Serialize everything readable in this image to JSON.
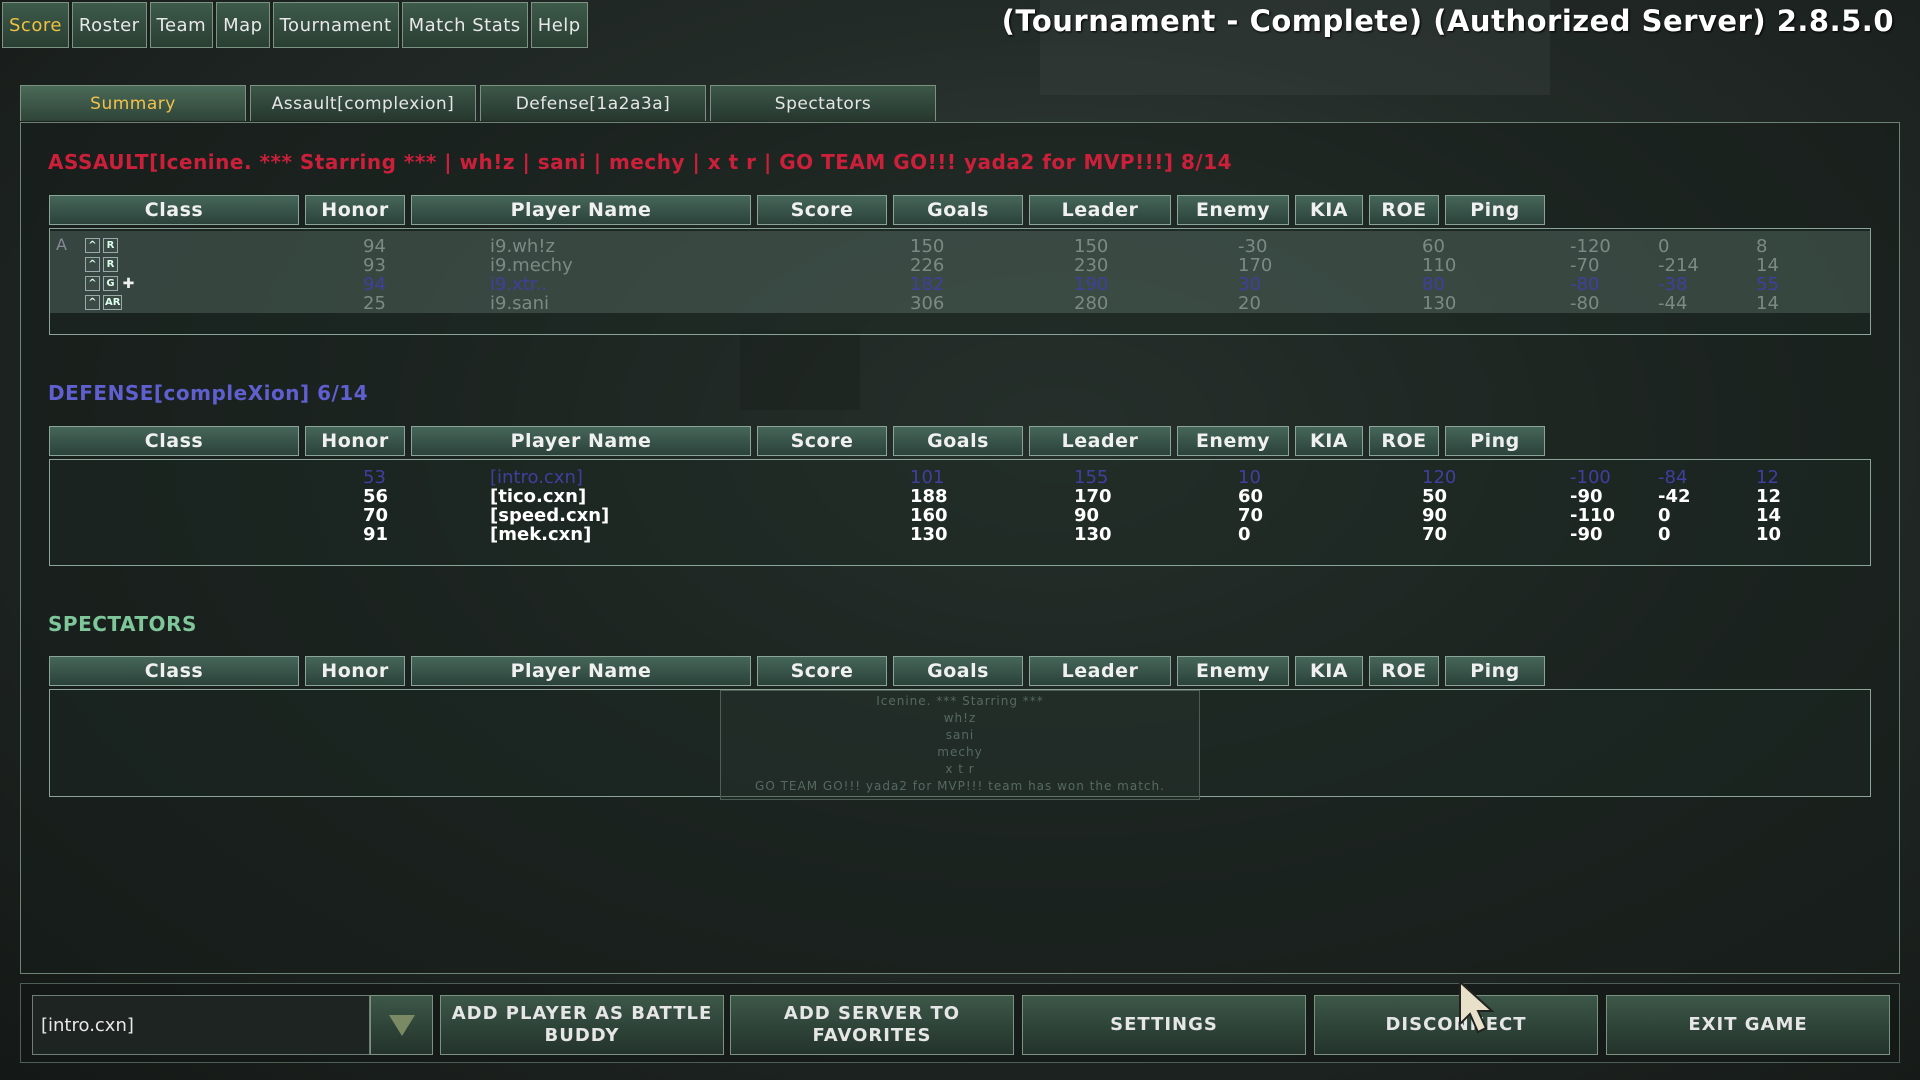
{
  "top_menu": [
    "Score",
    "Roster",
    "Team",
    "Map",
    "Tournament",
    "Match Stats",
    "Help"
  ],
  "server_title": "(Tournament - Complete) (Authorized Server)  2.8.5.0",
  "sub_tabs": [
    "Summary",
    "Assault[complexion]",
    "Defense[1a2a3a]",
    "Spectators"
  ],
  "columns": [
    "Class",
    "Honor",
    "Player Name",
    "Score",
    "Goals",
    "Leader",
    "Enemy",
    "KIA",
    "ROE",
    "Ping"
  ],
  "colors": {
    "assault": "#cc1f3a",
    "defense": "#5f5fd0",
    "spectators": "#7fc79a",
    "highlight": "#3f3f9f",
    "dim": "#7d8a84",
    "active_tab": "#f0c040"
  },
  "assault": {
    "heading": "ASSAULT[Icenine.  ***  Starring  ***  |  wh!z  |  sani  |  mechy  |  x t r  |  GO TEAM GO!!!  yada2 for MVP!!!] 8/14",
    "slot": "A",
    "rows": [
      {
        "icons": [
          "up",
          "R"
        ],
        "honor": "94",
        "name": "i9.wh!z",
        "score": "150",
        "goals": "150",
        "leader": "-30",
        "enemy": "60",
        "kia": "-120",
        "roe": "0",
        "ping": "8"
      },
      {
        "icons": [
          "up",
          "R"
        ],
        "honor": "93",
        "name": "i9.mechy",
        "score": "226",
        "goals": "230",
        "leader": "170",
        "enemy": "110",
        "kia": "-70",
        "roe": "-214",
        "ping": "14"
      },
      {
        "icons": [
          "up",
          "G",
          "+"
        ],
        "honor": "94",
        "name": "i9.xtr..",
        "score": "182",
        "goals": "190",
        "leader": "30",
        "enemy": "80",
        "kia": "-80",
        "roe": "-38",
        "ping": "55"
      },
      {
        "icons": [
          "up",
          "AR"
        ],
        "honor": "25",
        "name": "i9.sani",
        "score": "306",
        "goals": "280",
        "leader": "20",
        "enemy": "130",
        "kia": "-80",
        "roe": "-44",
        "ping": "14"
      }
    ]
  },
  "defense": {
    "heading": "DEFENSE[compleXion] 6/14",
    "rows": [
      {
        "honor": "53",
        "name": "[intro.cxn]",
        "score": "101",
        "goals": "155",
        "leader": "10",
        "enemy": "120",
        "kia": "-100",
        "roe": "-84",
        "ping": "12"
      },
      {
        "honor": "56",
        "name": "[tico.cxn]",
        "score": "188",
        "goals": "170",
        "leader": "60",
        "enemy": "50",
        "kia": "-90",
        "roe": "-42",
        "ping": "12"
      },
      {
        "honor": "70",
        "name": "[speed.cxn]",
        "score": "160",
        "goals": "90",
        "leader": "70",
        "enemy": "90",
        "kia": "-110",
        "roe": "0",
        "ping": "14"
      },
      {
        "honor": "91",
        "name": "[mek.cxn]",
        "score": "130",
        "goals": "130",
        "leader": "0",
        "enemy": "70",
        "kia": "-90",
        "roe": "0",
        "ping": "10"
      }
    ]
  },
  "spectators": {
    "heading": "SPECTATORS",
    "tooltip_lines": [
      "Icenine.  ***  Starring  ***",
      "wh!z",
      "sani",
      "mechy",
      "x t r",
      "GO TEAM GO!!!  yada2 for MVP!!! team has won the match."
    ]
  },
  "bottom": {
    "selected_player": "[intro.cxn]",
    "buttons": [
      "ADD PLAYER AS BATTLE BUDDY",
      "ADD SERVER TO FAVORITES",
      "SETTINGS",
      "DISCONNECT",
      "EXIT GAME"
    ]
  }
}
